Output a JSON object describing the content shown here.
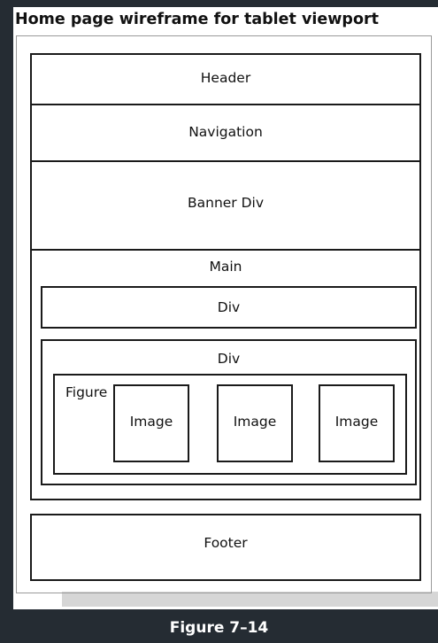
{
  "title": "Home page wireframe for tablet viewport",
  "caption": "Figure 7–14",
  "wireframe": {
    "header": "Header",
    "navigation": "Navigation",
    "banner": "Banner Div",
    "main": "Main",
    "div1": "Div",
    "div2": "Div",
    "figure": "Figure",
    "images": [
      "Image",
      "Image",
      "Image"
    ],
    "footer": "Footer"
  }
}
